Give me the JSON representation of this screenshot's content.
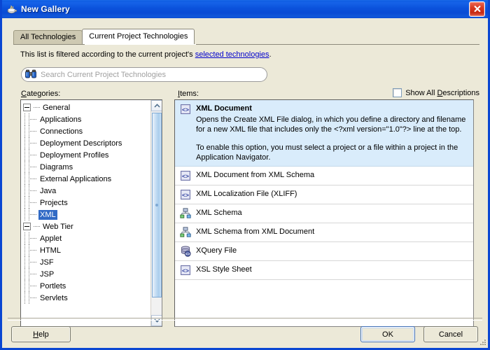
{
  "window": {
    "title": "New Gallery",
    "title_icon": "java-cup-icon",
    "close_label": "✕",
    "titlebar_color": "#0a4bd4",
    "frame_color": "#0a46d2",
    "face_color": "#ece9d8"
  },
  "tabs": [
    {
      "label": "All Technologies",
      "active": false
    },
    {
      "label": "Current Project Technologies",
      "active": true
    }
  ],
  "filter_note": {
    "prefix": "This list is filtered according to the current project's ",
    "link": "selected technologies",
    "suffix": "."
  },
  "search": {
    "placeholder": "Search Current Project Technologies",
    "value": "",
    "icon": "binoculars-icon"
  },
  "categories": {
    "label_mnemonic": "C",
    "label_rest": "ategories:",
    "nodes": [
      {
        "label": "General",
        "level": 0,
        "expanded": true,
        "selected": false
      },
      {
        "label": "Applications",
        "level": 1,
        "expanded": null,
        "selected": false
      },
      {
        "label": "Connections",
        "level": 1,
        "expanded": null,
        "selected": false
      },
      {
        "label": "Deployment Descriptors",
        "level": 1,
        "expanded": null,
        "selected": false
      },
      {
        "label": "Deployment Profiles",
        "level": 1,
        "expanded": null,
        "selected": false
      },
      {
        "label": "Diagrams",
        "level": 1,
        "expanded": null,
        "selected": false
      },
      {
        "label": "External Applications",
        "level": 1,
        "expanded": null,
        "selected": false
      },
      {
        "label": "Java",
        "level": 1,
        "expanded": null,
        "selected": false
      },
      {
        "label": "Projects",
        "level": 1,
        "expanded": null,
        "selected": false
      },
      {
        "label": "XML",
        "level": 1,
        "expanded": null,
        "selected": true
      },
      {
        "label": "Web Tier",
        "level": 0,
        "expanded": true,
        "selected": false
      },
      {
        "label": "Applet",
        "level": 1,
        "expanded": null,
        "selected": false
      },
      {
        "label": "HTML",
        "level": 1,
        "expanded": null,
        "selected": false
      },
      {
        "label": "JSF",
        "level": 1,
        "expanded": null,
        "selected": false
      },
      {
        "label": "JSP",
        "level": 1,
        "expanded": null,
        "selected": false
      },
      {
        "label": "Portlets",
        "level": 1,
        "expanded": null,
        "selected": false
      },
      {
        "label": "Servlets",
        "level": 1,
        "expanded": null,
        "selected": false
      }
    ],
    "selected_label": "XML",
    "selection_color": "#316ac5"
  },
  "items": {
    "label_mnemonic": "I",
    "label_rest": "tems:",
    "show_all_descriptions": {
      "checked": false,
      "prefix": "Show All ",
      "mnemonic": "D",
      "suffix": "escriptions"
    },
    "selected_index": 0,
    "selection_color": "#d9ecfb",
    "rows": [
      {
        "title": "XML Document",
        "icon": "xml-document-icon",
        "selected": true,
        "desc1": "Opens the Create XML File dialog, in which you define a directory and filename for a new XML file that includes only the <?xml version=\"1.0\"?> line at the top.",
        "desc2": "To enable this option, you must select a project or a file within a project in the Application Navigator."
      },
      {
        "title": "XML Document from XML Schema",
        "icon": "xml-document-icon",
        "selected": false
      },
      {
        "title": "XML Localization File (XLIFF)",
        "icon": "xml-document-icon",
        "selected": false
      },
      {
        "title": "XML Schema",
        "icon": "xml-schema-icon",
        "selected": false
      },
      {
        "title": "XML Schema from XML Document",
        "icon": "xml-schema-icon",
        "selected": false
      },
      {
        "title": "XQuery File",
        "icon": "xquery-file-icon",
        "selected": false
      },
      {
        "title": "XSL Style Sheet",
        "icon": "xml-document-icon",
        "selected": false
      }
    ]
  },
  "buttons": {
    "help": {
      "mnemonic": "H",
      "rest": "elp"
    },
    "ok": {
      "label": "OK",
      "default": true
    },
    "cancel": {
      "label": "Cancel"
    }
  }
}
